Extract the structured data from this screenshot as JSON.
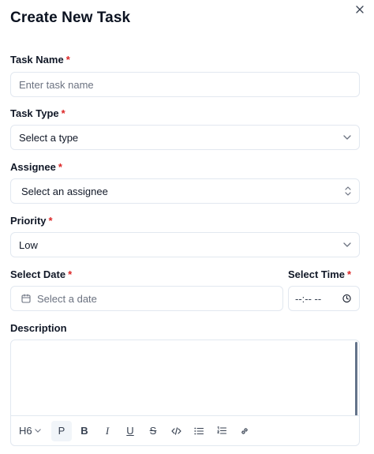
{
  "dialog": {
    "title": "Create New Task"
  },
  "form": {
    "task_name": {
      "label": "Task Name",
      "required_mark": "*",
      "placeholder": "Enter task name"
    },
    "task_type": {
      "label": "Task Type",
      "required_mark": "*",
      "placeholder": "Select a type"
    },
    "assignee": {
      "label": "Assignee",
      "required_mark": "*",
      "placeholder": "Select an assignee"
    },
    "priority": {
      "label": "Priority",
      "required_mark": "*",
      "value": "Low"
    },
    "date": {
      "label": "Select Date",
      "required_mark": "*",
      "placeholder": "Select a date"
    },
    "time": {
      "label": "Select Time",
      "required_mark": "*",
      "placeholder": "--:-- --"
    },
    "description": {
      "label": "Description"
    }
  },
  "toolbar": {
    "heading": "H6",
    "paragraph": "P",
    "bold": "B",
    "italic": "I",
    "underline": "U",
    "strike": "S"
  },
  "colors": {
    "required": "#dc2626",
    "border": "#e2e8f0",
    "placeholder": "#6b7280"
  }
}
